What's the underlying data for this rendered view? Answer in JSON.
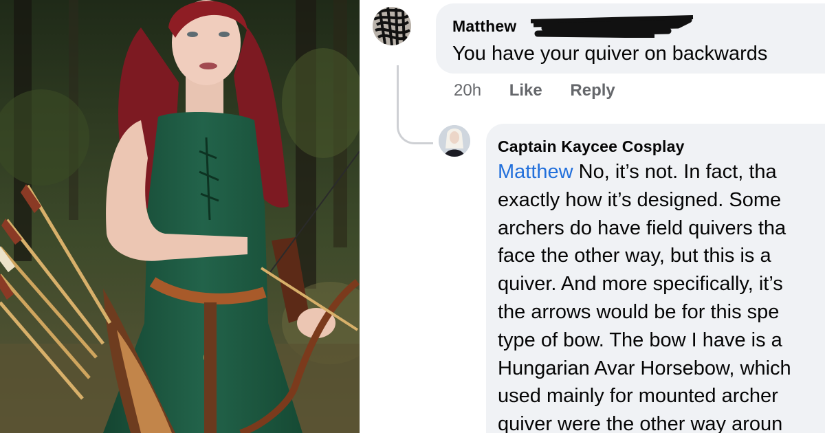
{
  "matthew_comment": {
    "author": "Matthew",
    "text": "You have your quiver on backwards",
    "time": "20h",
    "like_label": "Like",
    "reply_label": "Reply"
  },
  "kaycee_reply": {
    "author": "Captain Kaycee Cosplay",
    "mention": "Matthew",
    "lines": [
      " No, it’s not. In fact, tha",
      "exactly how it’s designed. Some",
      "archers do have field quivers tha",
      "face the other way, but this is a",
      "quiver. And more specifically, it’s",
      "the arrows would be for this spe",
      "type of bow. The bow I have is a",
      "Hungarian Avar Horsebow, which",
      "used mainly for mounted archer",
      "quiver were the other way aroun"
    ]
  },
  "colors": {
    "bubble": "#f0f2f5",
    "mention": "#216fdb",
    "meta_text": "#65676b",
    "dress": "#1f5a3e",
    "hair": "#8e1d24"
  },
  "icons": [
    "profile-avatar-scribbled",
    "profile-avatar-kaycee"
  ]
}
